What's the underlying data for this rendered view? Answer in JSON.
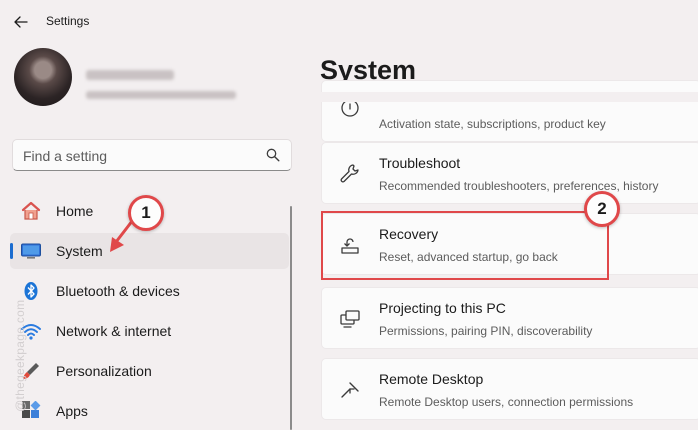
{
  "window": {
    "title": "Settings"
  },
  "account": {
    "name": "Sanbit Koley",
    "email": "sanbitkoley@gmail.com"
  },
  "search": {
    "placeholder": "Find a setting"
  },
  "nav": {
    "items": [
      {
        "label": "Home",
        "icon": "home-icon"
      },
      {
        "label": "System",
        "icon": "system-icon"
      },
      {
        "label": "Bluetooth & devices",
        "icon": "bluetooth-icon"
      },
      {
        "label": "Network & internet",
        "icon": "wifi-icon"
      },
      {
        "label": "Personalization",
        "icon": "brush-icon"
      },
      {
        "label": "Apps",
        "icon": "apps-icon"
      }
    ],
    "selected_index": 1
  },
  "page": {
    "title": "System"
  },
  "cards": [
    {
      "title": "",
      "desc": "Activation state, subscriptions, product key",
      "icon": "activation-icon"
    },
    {
      "title": "Troubleshoot",
      "desc": "Recommended troubleshooters, preferences, history",
      "icon": "wrench-icon"
    },
    {
      "title": "Recovery",
      "desc": "Reset, advanced startup, go back",
      "icon": "recovery-icon"
    },
    {
      "title": "Projecting to this PC",
      "desc": "Permissions, pairing PIN, discoverability",
      "icon": "project-icon"
    },
    {
      "title": "Remote Desktop",
      "desc": "Remote Desktop users, connection permissions",
      "icon": "remote-desktop-icon"
    }
  ],
  "annotations": {
    "step1": "1",
    "step2": "2",
    "color": "#e0484a"
  },
  "watermark": {
    "text": "@thegeekpage.com"
  },
  "colors": {
    "accent": "#1b6ccf",
    "background": "#f3eff0",
    "card": "#fbfbfb"
  }
}
